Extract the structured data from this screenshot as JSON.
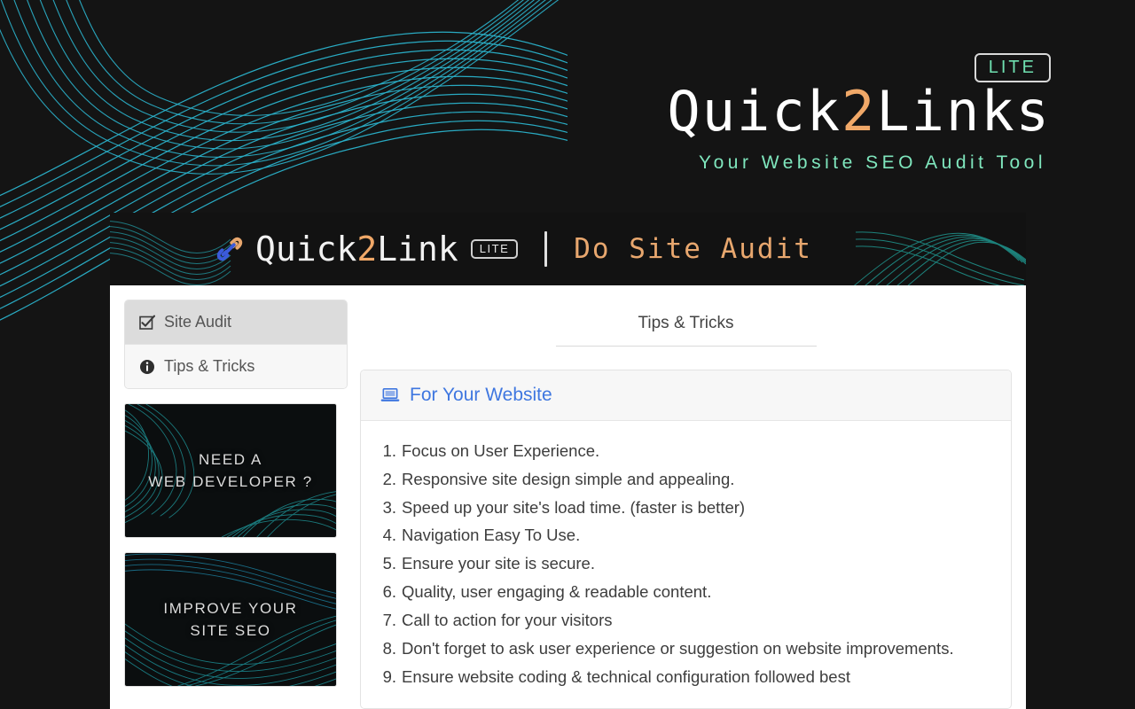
{
  "hero": {
    "badge": "LITE",
    "title_part1": "Quick",
    "title_accent": "2",
    "title_part2": "Links",
    "subtitle": "Your Website SEO Audit Tool"
  },
  "app_header": {
    "brand_part1": "Quick",
    "brand_accent": "2",
    "brand_part2": "Link",
    "badge": "LITE",
    "action": "Do Site Audit",
    "link_icon": "link-icon"
  },
  "sidebar": {
    "items": [
      {
        "label": "Site Audit",
        "icon": "checkbox-checked-icon",
        "active": true
      },
      {
        "label": "Tips & Tricks",
        "icon": "info-circle-icon",
        "active": false
      }
    ],
    "promos": [
      {
        "line1": "NEED A",
        "line2": "WEB DEVELOPER ?"
      },
      {
        "line1": "IMPROVE YOUR",
        "line2": "SITE SEO"
      }
    ]
  },
  "content": {
    "tab_title": "Tips & Tricks",
    "card": {
      "icon": "laptop-icon",
      "title": "For Your Website",
      "items": [
        "Focus on User Experience.",
        "Responsive site design simple and appealing.",
        "Speed up your site's load time. (faster is better)",
        "Navigation Easy To Use.",
        "Ensure your site is secure.",
        "Quality, user engaging & readable content.",
        "Call to action for your visitors",
        "Don't forget to ask user experience or suggestion on website improvements.",
        "Ensure website coding & technical configuration followed best"
      ]
    }
  },
  "colors": {
    "page_background": "#141414",
    "accent_orange": "#f0a868",
    "accent_mint": "#7fe6bd",
    "accent_cyan": "#29b8cf",
    "link_blue": "#3f77e0",
    "panel_white": "#ffffff"
  }
}
